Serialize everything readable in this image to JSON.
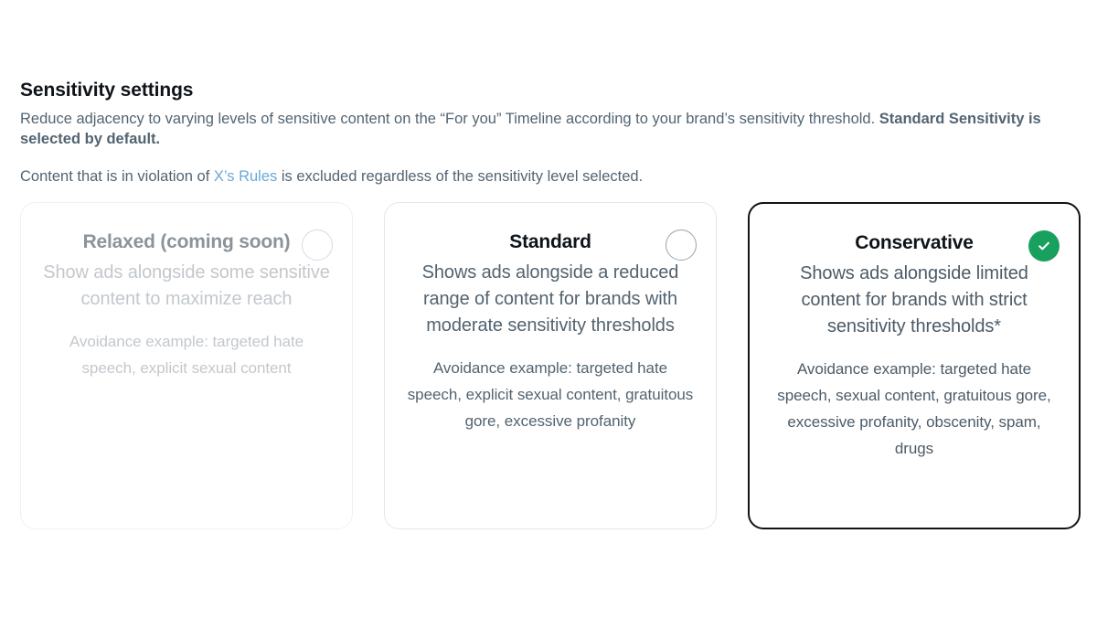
{
  "header": {
    "title": "Sensitivity settings",
    "intro_part1": "Reduce adjacency to varying levels of sensitive content on the “For you” Timeline according to your brand’s sensitivity threshold. ",
    "intro_bold": "Standard Sensitivity is selected by default.",
    "rules_prefix": "Content that is in violation of ",
    "rules_link": "X’s Rules",
    "rules_suffix": " is excluded regardless of the sensitivity level selected."
  },
  "colors": {
    "page_background": "#ffffff",
    "title_text": "#0f1419",
    "body_text": "#536471",
    "muted_text": "#c3c8cd",
    "link": "#6aa9d6",
    "selected_border": "#0f1419",
    "unselected_border": "#e3e6e9",
    "disabled_border": "#f0f1f3",
    "check_green": "#18a05f",
    "radio_outline": "#9aa4ae"
  },
  "cards": [
    {
      "id": "relaxed",
      "title": "Relaxed (coming soon)",
      "description": "Show ads alongside some sensitive content to maximize reach",
      "example": "Avoidance example: targeted hate speech, explicit sexual content",
      "state": "disabled",
      "indicator": "radio-unselected-icon",
      "selected": false
    },
    {
      "id": "standard",
      "title": "Standard",
      "description": "Shows ads alongside a reduced range of content for brands with moderate sensitivity thresholds",
      "example": "Avoidance example: targeted hate speech, explicit sexual content, gratuitous gore, excessive profanity",
      "state": "unselected",
      "indicator": "radio-unselected-icon",
      "selected": false
    },
    {
      "id": "conservative",
      "title": "Conservative",
      "description": "Shows ads alongside limited content for brands with strict sensitivity thresholds*",
      "example": "Avoidance example: targeted hate speech, sexual content, gratuitous gore, excessive profanity, obscenity, spam, drugs",
      "state": "selected",
      "indicator": "check-circle-icon",
      "selected": true
    }
  ]
}
